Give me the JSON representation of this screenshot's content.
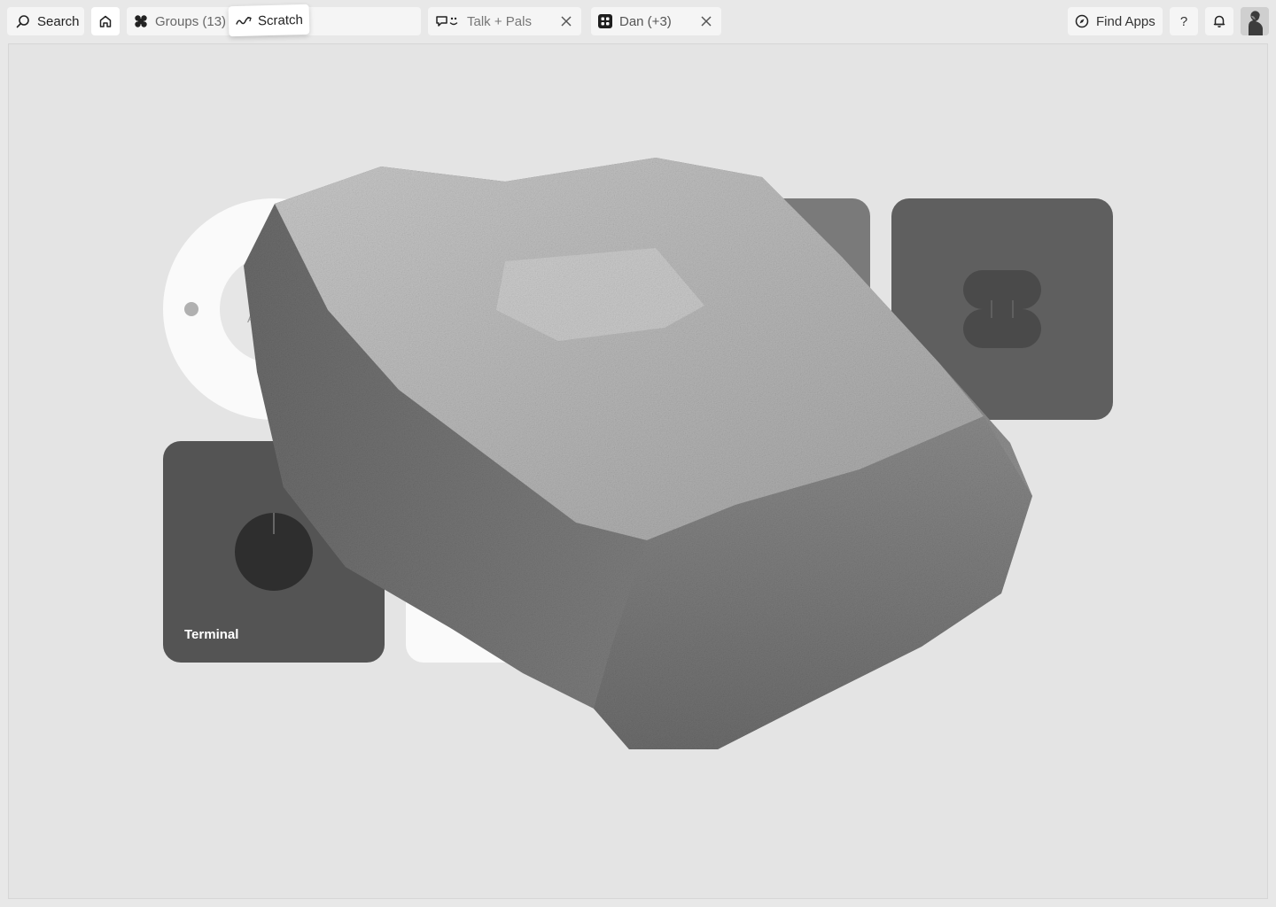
{
  "topbar": {
    "search_label": "Search",
    "groups_label": "Groups (13)",
    "scratch_label": "Scratch",
    "talk_tab_label": "Talk + Pals",
    "dan_tab_label": "Dan (+3)",
    "find_apps_label": "Find Apps",
    "help_label": "?"
  },
  "icons": {
    "search": "search-icon",
    "home": "home-icon",
    "groups": "clover-icon",
    "scratch": "squiggle-icon",
    "talk": "chat-bubble-icon",
    "dan": "grid-app-icon",
    "close": "close-icon",
    "find_apps": "compass-icon",
    "bell": "bell-icon"
  },
  "workspace": {
    "dial_letter": "A",
    "terminal_label": "Terminal"
  },
  "colors": {
    "background": "#e8e8e8",
    "pill": "#f5f5f5",
    "dark_card": "#5f5f5f",
    "terminal_card": "#545454"
  }
}
